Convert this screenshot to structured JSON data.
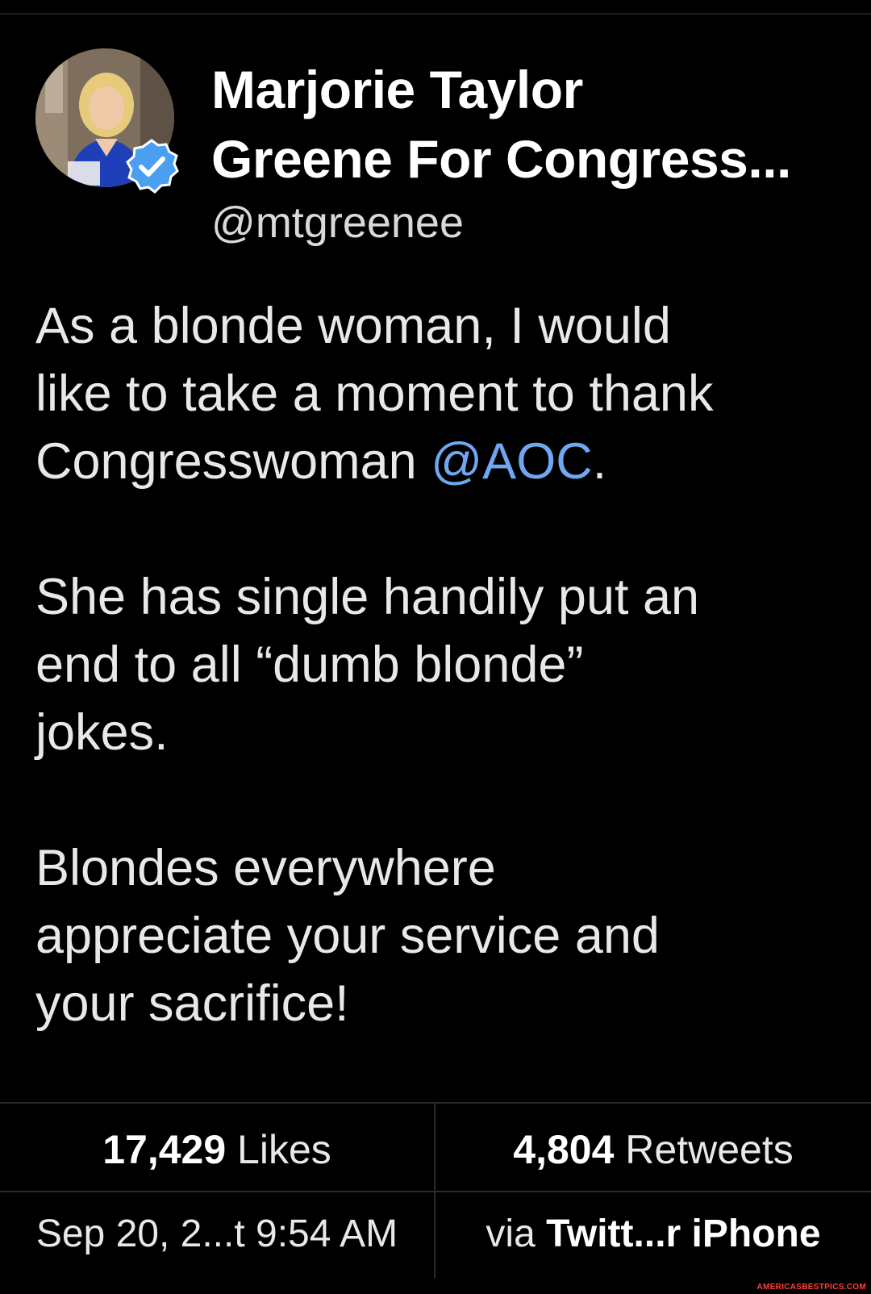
{
  "profile": {
    "name_line1": "Marjorie Taylor",
    "name_line2": "Greene For Congress...",
    "handle": "@mtgreenee",
    "verified": true,
    "avatar_icon": "profile-photo"
  },
  "tweet": {
    "line1": "As a blonde woman, I would",
    "line2": "like to take a moment to thank",
    "line3_prefix": "Congresswoman ",
    "mention": "@AOC",
    "line3_suffix": ".",
    "para2_line1": "She has single handily put an",
    "para2_line2": "end to all “dumb blonde”",
    "para2_line3": "jokes.",
    "para3_line1": "Blondes everywhere",
    "para3_line2": "appreciate your service and",
    "para3_line3": "your sacrifice!"
  },
  "stats": {
    "likes_count": "17,429",
    "likes_label": "Likes",
    "retweets_count": "4,804",
    "retweets_label": "Retweets"
  },
  "meta": {
    "timestamp": "Sep 20, 2...t 9:54 AM",
    "via_prefix": "via ",
    "client": "Twitt...r iPhone"
  },
  "colors": {
    "background": "#000000",
    "mention": "#6fa8f0",
    "verified_badge": "#4a9ff0"
  },
  "watermark": "AMERICASBESTPICS.COM"
}
